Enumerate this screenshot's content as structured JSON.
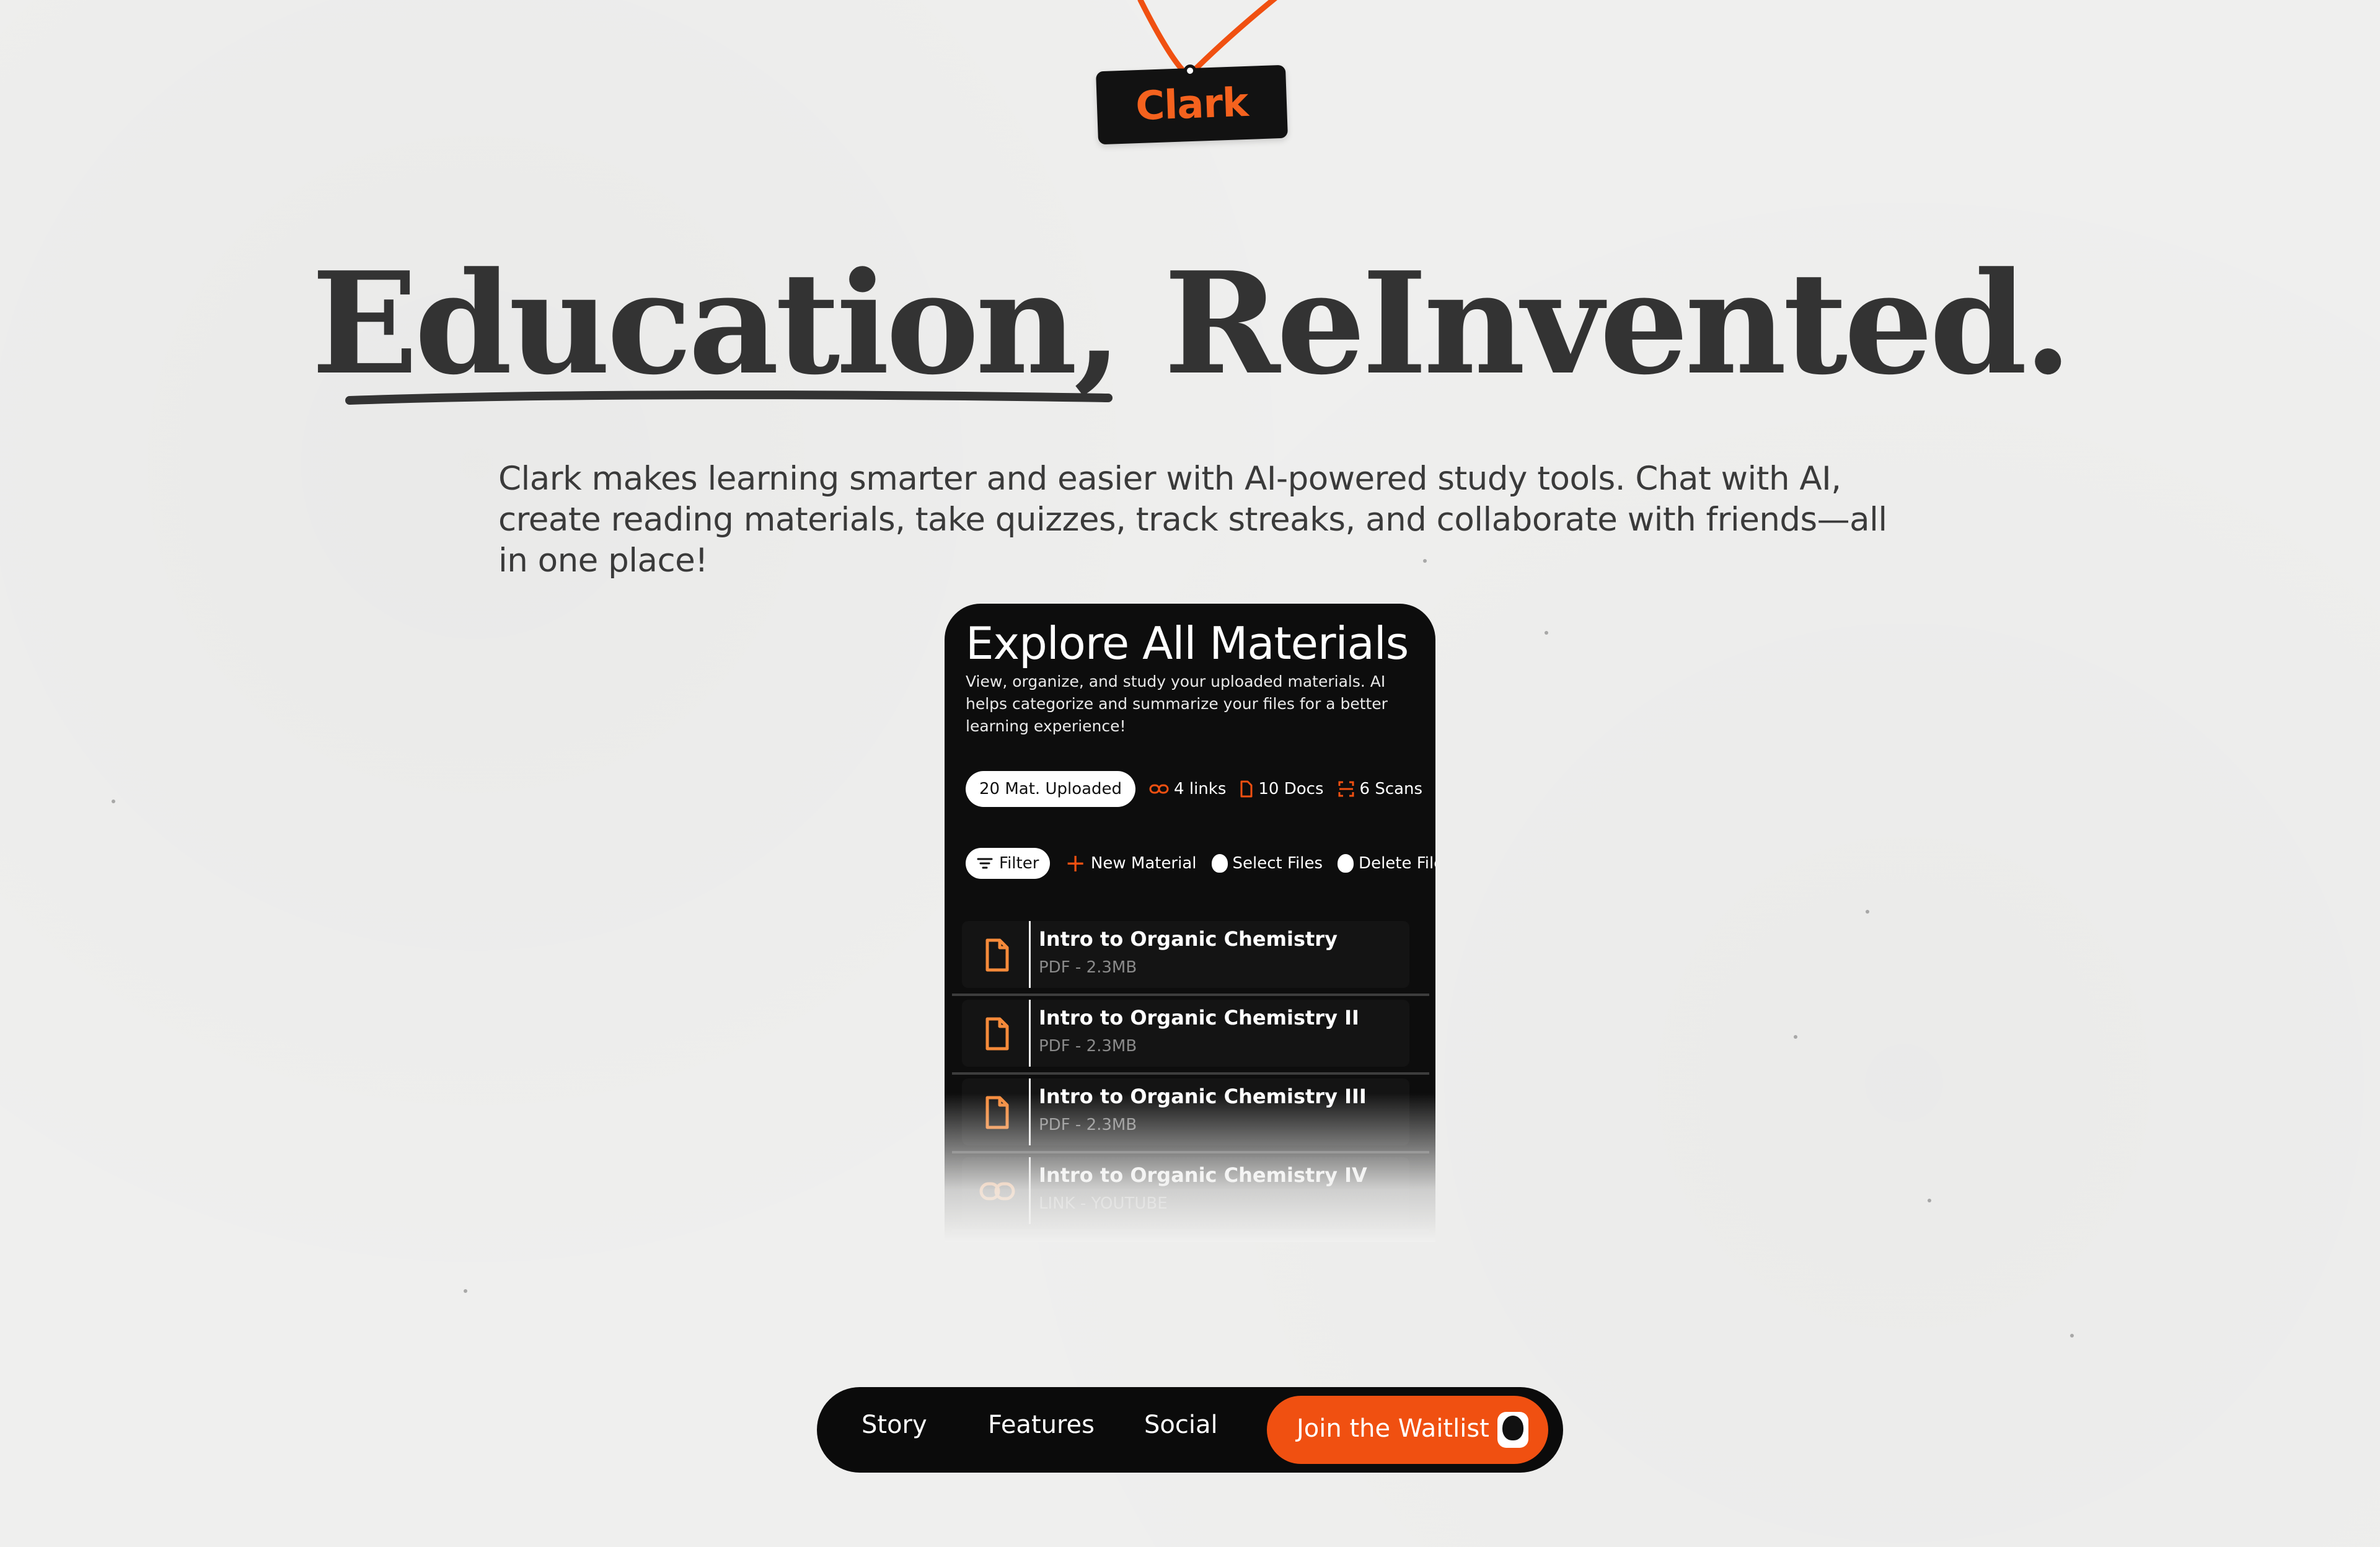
{
  "brand": {
    "logo_text": "Clark",
    "accent_color": "#f05011"
  },
  "hero": {
    "headline": "Education, ReInvented.",
    "intro": "Clark makes learning smarter and easier with AI-powered study tools. Chat with AI, create reading materials, take quizzes, track streaks, and collaborate with friends—all in one place!"
  },
  "app_preview": {
    "title": "Explore All Materials",
    "description": "View, organize, and study your uploaded materials. AI helps categorize and summarize your files for a better learning experience!",
    "stats": {
      "uploaded": "20 Mat. Uploaded",
      "links": "4 links",
      "docs": "10 Docs",
      "scans": "6 Scans"
    },
    "toolbar": {
      "filter": "Filter",
      "new_material": "New Material",
      "select_files": "Select Files",
      "delete_files": "Delete Files"
    },
    "materials": [
      {
        "title": "Intro to Organic Chemistry",
        "meta": "PDF - 2.3MB",
        "icon": "document-icon"
      },
      {
        "title": "Intro to Organic Chemistry II",
        "meta": "PDF - 2.3MB",
        "icon": "document-icon"
      },
      {
        "title": "Intro to Organic Chemistry III",
        "meta": "PDF - 2.3MB",
        "icon": "document-icon"
      },
      {
        "title": "Intro to Organic Chemistry IV",
        "meta": "LINK - YOUTUBE",
        "icon": "link-icon"
      }
    ]
  },
  "nav": {
    "story": "Story",
    "features": "Features",
    "social": "Social",
    "cta": "Join the Waitlist"
  }
}
